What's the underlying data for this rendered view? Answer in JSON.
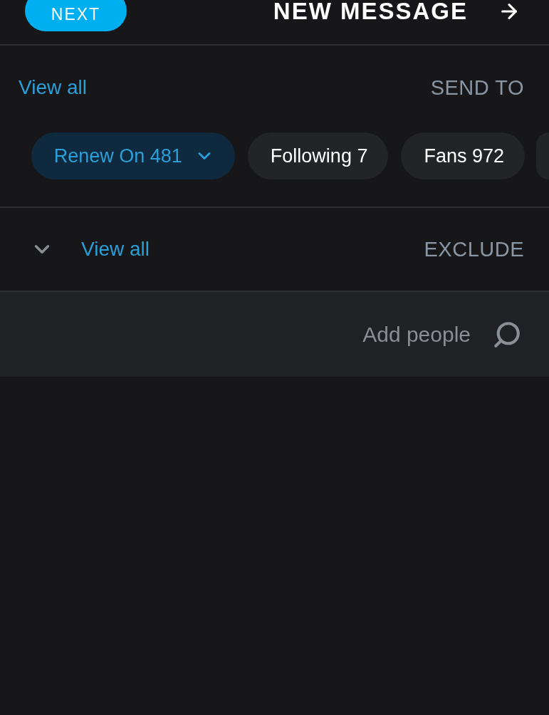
{
  "header": {
    "next_button": "NEXT",
    "title": "NEW MESSAGE"
  },
  "send_to": {
    "view_all": "View all",
    "heading": "SEND TO",
    "chips": [
      {
        "label": "Renew On 481",
        "selected": true,
        "kind": "dropdown"
      },
      {
        "label": "Following 7",
        "selected": false,
        "kind": "plain"
      },
      {
        "label": "Fans 972",
        "selected": false,
        "kind": "plain"
      }
    ]
  },
  "exclude": {
    "expanded": false,
    "view_all": "View all",
    "heading": "EXCLUDE"
  },
  "search": {
    "placeholder": "Add people"
  }
}
